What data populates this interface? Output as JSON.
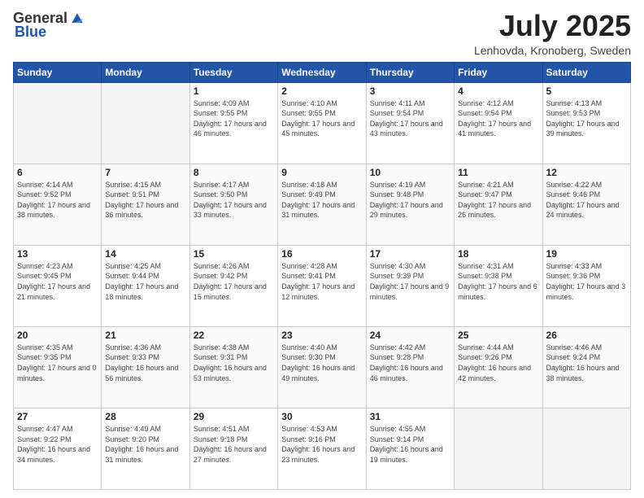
{
  "header": {
    "logo_general": "General",
    "logo_blue": "Blue",
    "month_title": "July 2025",
    "location": "Lenhovda, Kronoberg, Sweden"
  },
  "weekdays": [
    "Sunday",
    "Monday",
    "Tuesday",
    "Wednesday",
    "Thursday",
    "Friday",
    "Saturday"
  ],
  "weeks": [
    [
      {
        "day": "",
        "info": ""
      },
      {
        "day": "",
        "info": ""
      },
      {
        "day": "1",
        "info": "Sunrise: 4:09 AM\nSunset: 9:55 PM\nDaylight: 17 hours and 46 minutes."
      },
      {
        "day": "2",
        "info": "Sunrise: 4:10 AM\nSunset: 9:55 PM\nDaylight: 17 hours and 45 minutes."
      },
      {
        "day": "3",
        "info": "Sunrise: 4:11 AM\nSunset: 9:54 PM\nDaylight: 17 hours and 43 minutes."
      },
      {
        "day": "4",
        "info": "Sunrise: 4:12 AM\nSunset: 9:54 PM\nDaylight: 17 hours and 41 minutes."
      },
      {
        "day": "5",
        "info": "Sunrise: 4:13 AM\nSunset: 9:53 PM\nDaylight: 17 hours and 39 minutes."
      }
    ],
    [
      {
        "day": "6",
        "info": "Sunrise: 4:14 AM\nSunset: 9:52 PM\nDaylight: 17 hours and 38 minutes."
      },
      {
        "day": "7",
        "info": "Sunrise: 4:15 AM\nSunset: 9:51 PM\nDaylight: 17 hours and 36 minutes."
      },
      {
        "day": "8",
        "info": "Sunrise: 4:17 AM\nSunset: 9:50 PM\nDaylight: 17 hours and 33 minutes."
      },
      {
        "day": "9",
        "info": "Sunrise: 4:18 AM\nSunset: 9:49 PM\nDaylight: 17 hours and 31 minutes."
      },
      {
        "day": "10",
        "info": "Sunrise: 4:19 AM\nSunset: 9:48 PM\nDaylight: 17 hours and 29 minutes."
      },
      {
        "day": "11",
        "info": "Sunrise: 4:21 AM\nSunset: 9:47 PM\nDaylight: 17 hours and 26 minutes."
      },
      {
        "day": "12",
        "info": "Sunrise: 4:22 AM\nSunset: 9:46 PM\nDaylight: 17 hours and 24 minutes."
      }
    ],
    [
      {
        "day": "13",
        "info": "Sunrise: 4:23 AM\nSunset: 9:45 PM\nDaylight: 17 hours and 21 minutes."
      },
      {
        "day": "14",
        "info": "Sunrise: 4:25 AM\nSunset: 9:44 PM\nDaylight: 17 hours and 18 minutes."
      },
      {
        "day": "15",
        "info": "Sunrise: 4:26 AM\nSunset: 9:42 PM\nDaylight: 17 hours and 15 minutes."
      },
      {
        "day": "16",
        "info": "Sunrise: 4:28 AM\nSunset: 9:41 PM\nDaylight: 17 hours and 12 minutes."
      },
      {
        "day": "17",
        "info": "Sunrise: 4:30 AM\nSunset: 9:39 PM\nDaylight: 17 hours and 9 minutes."
      },
      {
        "day": "18",
        "info": "Sunrise: 4:31 AM\nSunset: 9:38 PM\nDaylight: 17 hours and 6 minutes."
      },
      {
        "day": "19",
        "info": "Sunrise: 4:33 AM\nSunset: 9:36 PM\nDaylight: 17 hours and 3 minutes."
      }
    ],
    [
      {
        "day": "20",
        "info": "Sunrise: 4:35 AM\nSunset: 9:35 PM\nDaylight: 17 hours and 0 minutes."
      },
      {
        "day": "21",
        "info": "Sunrise: 4:36 AM\nSunset: 9:33 PM\nDaylight: 16 hours and 56 minutes."
      },
      {
        "day": "22",
        "info": "Sunrise: 4:38 AM\nSunset: 9:31 PM\nDaylight: 16 hours and 53 minutes."
      },
      {
        "day": "23",
        "info": "Sunrise: 4:40 AM\nSunset: 9:30 PM\nDaylight: 16 hours and 49 minutes."
      },
      {
        "day": "24",
        "info": "Sunrise: 4:42 AM\nSunset: 9:28 PM\nDaylight: 16 hours and 46 minutes."
      },
      {
        "day": "25",
        "info": "Sunrise: 4:44 AM\nSunset: 9:26 PM\nDaylight: 16 hours and 42 minutes."
      },
      {
        "day": "26",
        "info": "Sunrise: 4:46 AM\nSunset: 9:24 PM\nDaylight: 16 hours and 38 minutes."
      }
    ],
    [
      {
        "day": "27",
        "info": "Sunrise: 4:47 AM\nSunset: 9:22 PM\nDaylight: 16 hours and 34 minutes."
      },
      {
        "day": "28",
        "info": "Sunrise: 4:49 AM\nSunset: 9:20 PM\nDaylight: 16 hours and 31 minutes."
      },
      {
        "day": "29",
        "info": "Sunrise: 4:51 AM\nSunset: 9:18 PM\nDaylight: 16 hours and 27 minutes."
      },
      {
        "day": "30",
        "info": "Sunrise: 4:53 AM\nSunset: 9:16 PM\nDaylight: 16 hours and 23 minutes."
      },
      {
        "day": "31",
        "info": "Sunrise: 4:55 AM\nSunset: 9:14 PM\nDaylight: 16 hours and 19 minutes."
      },
      {
        "day": "",
        "info": ""
      },
      {
        "day": "",
        "info": ""
      }
    ]
  ]
}
